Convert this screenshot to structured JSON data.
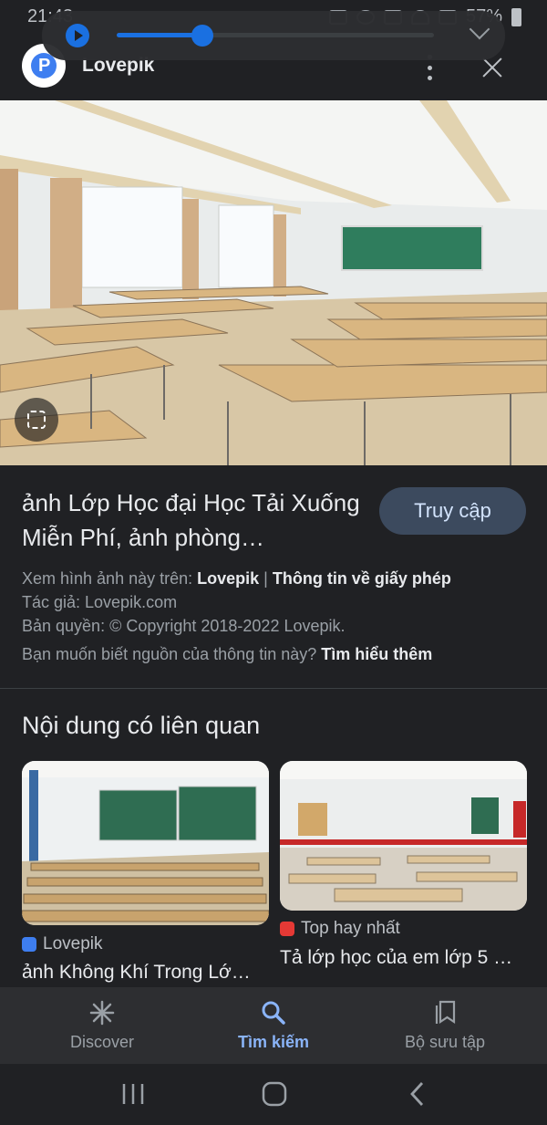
{
  "status_bar": {
    "time": "21:43",
    "battery": "57%"
  },
  "media_player": {
    "progress": 0.27
  },
  "header": {
    "site_name": "Lovepik"
  },
  "result": {
    "title": "ảnh Lớp Học đại Học Tải Xuống Miễn Phí, ảnh phòng…",
    "visit_button": "Truy cập",
    "view_on_prefix": "Xem hình ảnh này trên: ",
    "view_on_site": "Lovepik",
    "view_on_sep": " | ",
    "license_link": "Thông tin về giấy phép",
    "author": "Tác giả: Lovepik.com",
    "copyright": "Bản quyền: © Copyright 2018-2022 Lovepik.",
    "learn_prefix": "Bạn muốn biết nguồn của thông tin này? ",
    "learn_link": "Tìm hiểu thêm"
  },
  "related": {
    "heading": "Nội dung có liên quan",
    "cards": [
      {
        "source": "Lovepik",
        "title": "ảnh Không Khí Trong Lớ…"
      },
      {
        "source": "Top hay nhất",
        "title": "Tả lớp học của em lớp 5 …"
      }
    ]
  },
  "bottom_nav": {
    "items": [
      {
        "label": "Discover"
      },
      {
        "label": "Tìm kiếm"
      },
      {
        "label": "Bộ sưu tập"
      }
    ]
  },
  "colors": {
    "accent": "#8ab4f8",
    "background": "#202124"
  }
}
